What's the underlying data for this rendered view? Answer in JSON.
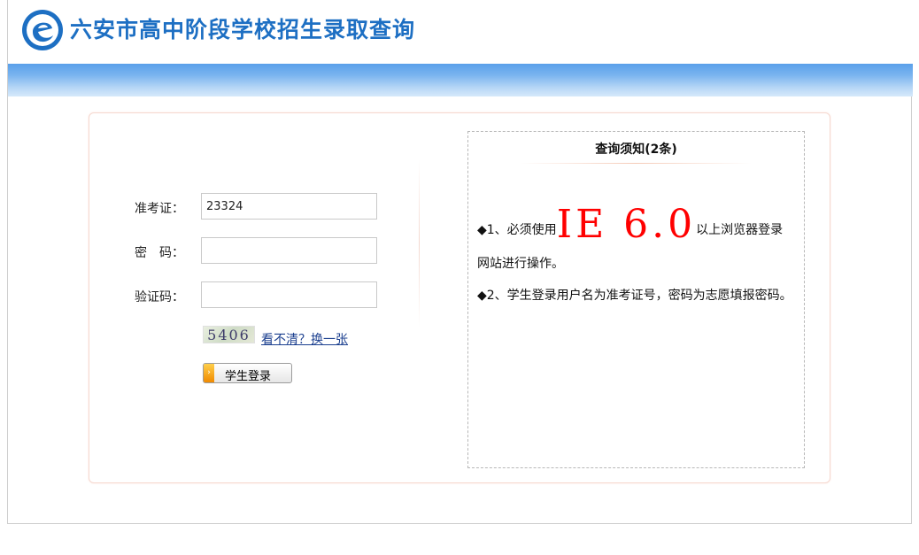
{
  "header": {
    "title": "六安市高中阶段学校招生录取查询",
    "logo_icon": "circular-e-logo-icon"
  },
  "colors": {
    "title": "#1d6fc3",
    "banner_top": "#5aa0ea",
    "banner_bottom": "#d6e9fb",
    "notice_highlight": "#ff0000",
    "link": "#1b3f8f"
  },
  "login": {
    "exam_number_label": "准考证：",
    "exam_number_value": "23324",
    "password_label": "密　码：",
    "password_value": "",
    "captcha_label": "验证码：",
    "captcha_value": "",
    "captcha_image_text": "5406",
    "refresh_link": "看不清？换一张",
    "submit_label": "学生登录"
  },
  "notice": {
    "title": "查询须知(2条)",
    "item1_prefix": "◆1、必须使用",
    "item1_highlight": "IE 6.0",
    "item1_suffix": "以上浏览器登录网站进行操作。",
    "item2": "◆2、学生登录用户名为准考证号，密码为志愿填报密码。"
  }
}
